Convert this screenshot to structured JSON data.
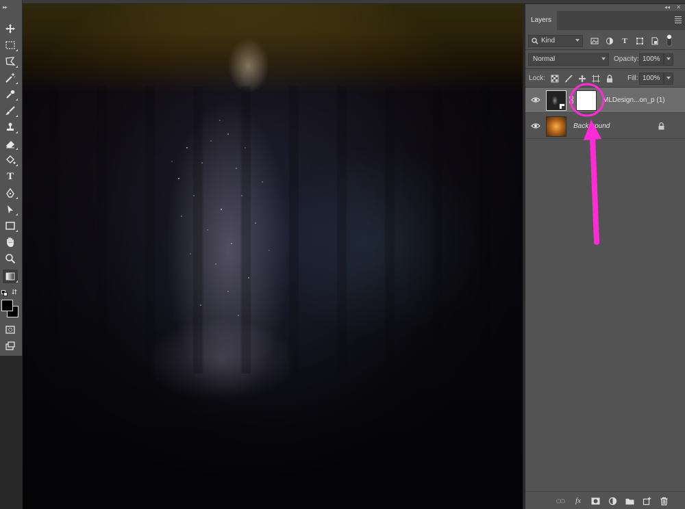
{
  "app": {
    "name": "Photoshop"
  },
  "toolbar": {
    "tools": [
      {
        "name": "move-tool",
        "icon": "move-icon"
      },
      {
        "name": "marquee-tool",
        "icon": "rect-marquee-icon"
      },
      {
        "name": "lasso-tool",
        "icon": "polygonal-lasso-icon"
      },
      {
        "name": "magic-wand-tool",
        "icon": "magic-wand-icon"
      },
      {
        "name": "eyedropper-tool",
        "icon": "eyedropper-icon"
      },
      {
        "name": "brush-tool",
        "icon": "brush-icon"
      },
      {
        "name": "stamp-tool",
        "icon": "clone-stamp-icon"
      },
      {
        "name": "eraser-tool",
        "icon": "eraser-icon"
      },
      {
        "name": "paint-bucket-tool",
        "icon": "paint-bucket-icon"
      },
      {
        "name": "type-tool",
        "icon": "type-icon"
      },
      {
        "name": "pen-tool",
        "icon": "pen-icon"
      },
      {
        "name": "path-select-tool",
        "icon": "path-select-icon"
      },
      {
        "name": "rectangle-tool",
        "icon": "rectangle-icon"
      },
      {
        "name": "hand-tool",
        "icon": "hand-icon"
      },
      {
        "name": "zoom-tool",
        "icon": "zoom-icon"
      },
      {
        "name": "gradient-tool",
        "icon": "gradient-icon"
      }
    ],
    "type_glyph": "T",
    "foreground_color": "#000000",
    "background_color": "#000000"
  },
  "panel": {
    "tab_label": "Layers",
    "filter": {
      "kind_label": "Kind"
    },
    "blend_mode": "Normal",
    "opacity_label": "Opacity:",
    "opacity_value": "100%",
    "lock_label": "Lock:",
    "fill_label": "Fill:",
    "fill_value": "100%",
    "layers": [
      {
        "name": "MLDesign...on_p (1)",
        "selected": true,
        "visible": true,
        "has_mask": true,
        "smart_object": true
      },
      {
        "name": "Background",
        "selected": false,
        "visible": true,
        "locked": true
      }
    ]
  },
  "annotation": {
    "color": "#ff2bd6",
    "type": "arrow-and-circle",
    "target": "layer-mask-thumbnail"
  }
}
